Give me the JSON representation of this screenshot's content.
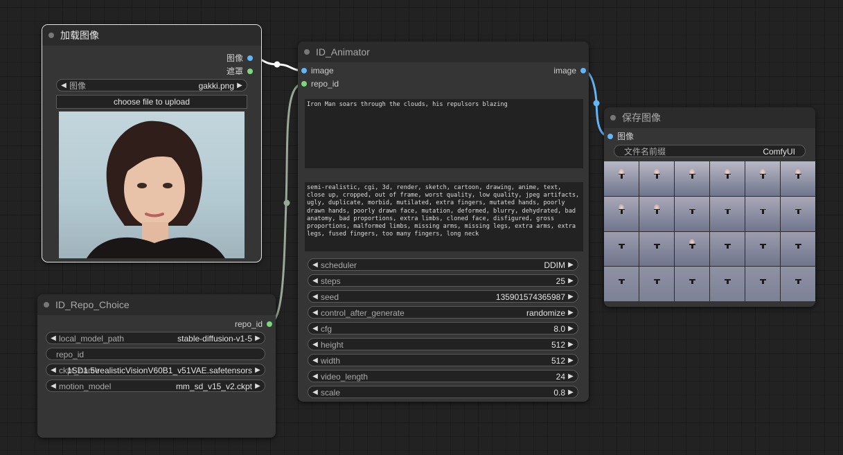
{
  "load_image_node": {
    "title": "加载图像",
    "outputs": [
      "图像",
      "遮罩"
    ],
    "image_widget": {
      "label": "图像",
      "value": "gakki.png"
    },
    "upload_button": "choose file to upload"
  },
  "animator_node": {
    "title": "ID_Animator",
    "inputs": [
      "image",
      "repo_id"
    ],
    "output": "image",
    "positive_prompt": "Iron Man soars through the clouds, his repulsors blazing",
    "negative_prompt": "semi-realistic, cgi, 3d, render, sketch, cartoon, drawing, anime, text, close up, cropped, out of frame, worst quality, low quality, jpeg artifacts, ugly, duplicate, morbid, mutilated, extra fingers, mutated hands, poorly drawn hands, poorly drawn face, mutation, deformed, blurry, dehydrated, bad anatomy, bad proportions, extra limbs, cloned face, disfigured, gross proportions, malformed limbs, missing arms, missing legs, extra arms, extra legs, fused fingers, too many fingers, long neck",
    "widgets": [
      {
        "label": "scheduler",
        "value": "DDIM"
      },
      {
        "label": "steps",
        "value": "25"
      },
      {
        "label": "seed",
        "value": "135901574365987"
      },
      {
        "label": "control_after_generate",
        "value": "randomize"
      },
      {
        "label": "cfg",
        "value": "8.0"
      },
      {
        "label": "height",
        "value": "512"
      },
      {
        "label": "width",
        "value": "512"
      },
      {
        "label": "video_length",
        "value": "24"
      },
      {
        "label": "scale",
        "value": "0.8"
      }
    ]
  },
  "save_image_node": {
    "title": "保存图像",
    "input": "图像",
    "prefix_widget": {
      "label": "文件名前缀",
      "value": "ComfyUI"
    }
  },
  "repo_node": {
    "title": "ID_Repo_Choice",
    "output": "repo_id",
    "widgets": [
      {
        "label": "local_model_path",
        "value": "stable-diffusion-v1-5"
      },
      {
        "label": "repo_id",
        "value": ""
      },
      {
        "label": "ckpt_name",
        "value": "1SD1.5\\realisticVisionV60B1_v51VAE.safetensors"
      },
      {
        "label": "motion_model",
        "value": "mm_sd_v15_v2.ckpt"
      }
    ]
  },
  "colors": {
    "image_link": "#64b5f6",
    "repo_link": "#9aa89a",
    "selected_link": "#ffffff"
  }
}
